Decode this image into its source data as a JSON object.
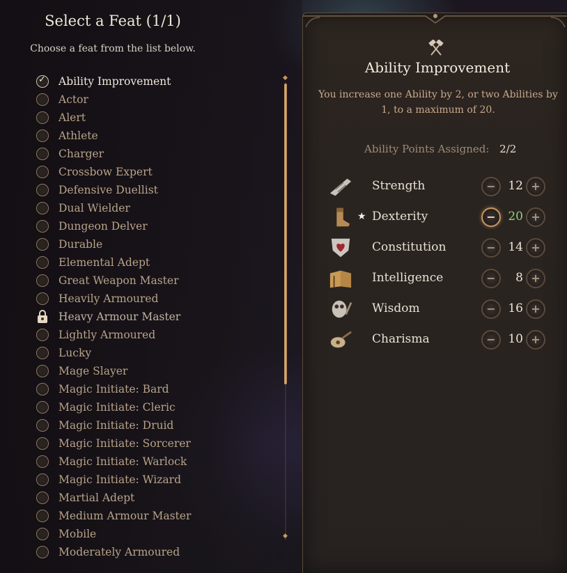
{
  "left": {
    "title": "Select a Feat (1/1)",
    "subtitle": "Choose a feat from the list below.",
    "feats": [
      {
        "label": "Ability Improvement",
        "state": "selected"
      },
      {
        "label": "Actor",
        "state": "available"
      },
      {
        "label": "Alert",
        "state": "available"
      },
      {
        "label": "Athlete",
        "state": "available"
      },
      {
        "label": "Charger",
        "state": "available"
      },
      {
        "label": "Crossbow Expert",
        "state": "available"
      },
      {
        "label": "Defensive Duellist",
        "state": "available"
      },
      {
        "label": "Dual Wielder",
        "state": "available"
      },
      {
        "label": "Dungeon Delver",
        "state": "available"
      },
      {
        "label": "Durable",
        "state": "available"
      },
      {
        "label": "Elemental Adept",
        "state": "available"
      },
      {
        "label": "Great Weapon Master",
        "state": "available"
      },
      {
        "label": "Heavily Armoured",
        "state": "available"
      },
      {
        "label": "Heavy Armour Master",
        "state": "locked"
      },
      {
        "label": "Lightly Armoured",
        "state": "available"
      },
      {
        "label": "Lucky",
        "state": "available"
      },
      {
        "label": "Mage Slayer",
        "state": "available"
      },
      {
        "label": "Magic Initiate: Bard",
        "state": "available"
      },
      {
        "label": "Magic Initiate: Cleric",
        "state": "available"
      },
      {
        "label": "Magic Initiate: Druid",
        "state": "available"
      },
      {
        "label": "Magic Initiate: Sorcerer",
        "state": "available"
      },
      {
        "label": "Magic Initiate: Warlock",
        "state": "available"
      },
      {
        "label": "Magic Initiate: Wizard",
        "state": "available"
      },
      {
        "label": "Martial Adept",
        "state": "available"
      },
      {
        "label": "Medium Armour Master",
        "state": "available"
      },
      {
        "label": "Mobile",
        "state": "available"
      },
      {
        "label": "Moderately Armoured",
        "state": "available"
      }
    ]
  },
  "detail": {
    "icon": "crossed-hammers-icon",
    "title": "Ability Improvement",
    "description": "You increase one Ability by 2, or two Abilities by 1, to a maximum of 20.",
    "points_label": "Ability Points Assigned:",
    "points_value": "2/2",
    "abilities": [
      {
        "name": "Strength",
        "value": "12",
        "icon": "gauntlet-icon",
        "starred": false,
        "boosted": false,
        "minus_active": false
      },
      {
        "name": "Dexterity",
        "value": "20",
        "icon": "boot-icon",
        "starred": true,
        "boosted": true,
        "minus_active": true
      },
      {
        "name": "Constitution",
        "value": "14",
        "icon": "heart-shield-icon",
        "starred": false,
        "boosted": false,
        "minus_active": false
      },
      {
        "name": "Intelligence",
        "value": "8",
        "icon": "open-book-icon",
        "starred": false,
        "boosted": false,
        "minus_active": false
      },
      {
        "name": "Wisdom",
        "value": "16",
        "icon": "owl-icon",
        "starred": false,
        "boosted": false,
        "minus_active": false
      },
      {
        "name": "Charisma",
        "value": "10",
        "icon": "lute-icon",
        "starred": false,
        "boosted": false,
        "minus_active": false
      }
    ],
    "star_glyph": "★",
    "minus_glyph": "−",
    "plus_glyph": "+"
  },
  "colors": {
    "accent": "#c79762",
    "boosted_value": "#8fd27a",
    "inactive_feat_text": "#b9a389"
  }
}
